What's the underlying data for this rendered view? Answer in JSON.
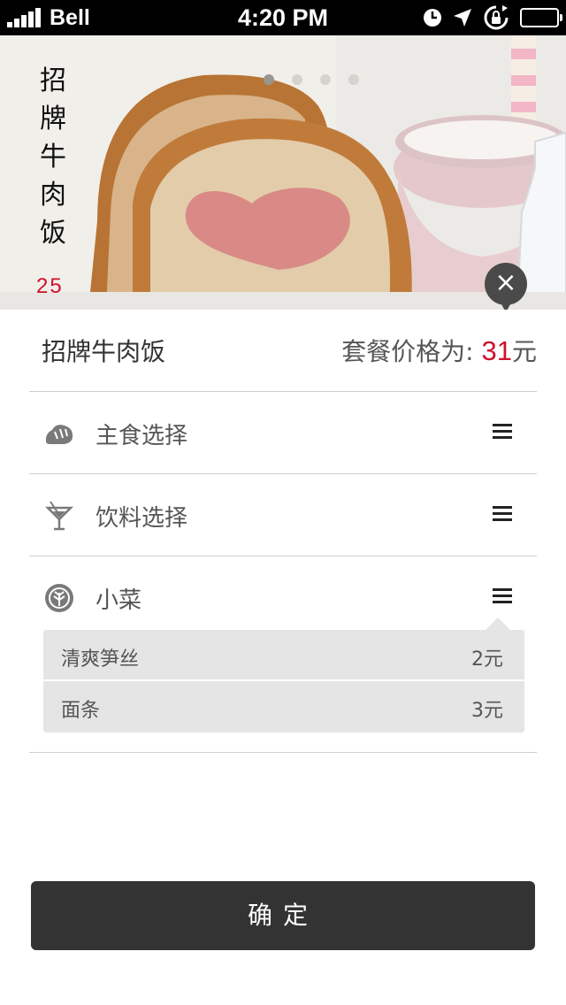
{
  "status_bar": {
    "carrier": "Bell",
    "time": "4:20 PM"
  },
  "hero": {
    "title_chars": [
      "招",
      "牌",
      "牛",
      "肉",
      "饭"
    ],
    "price": "25",
    "carousel": {
      "total": 4,
      "active_index": 0
    }
  },
  "close_label": "×",
  "order": {
    "name": "招牌牛肉饭",
    "price_label": "套餐价格为:",
    "price_value": "31",
    "price_unit": "元"
  },
  "sections": [
    {
      "label": "主食选择",
      "icon": "bread-icon"
    },
    {
      "label": "饮料选择",
      "icon": "cocktail-icon"
    },
    {
      "label": "小菜",
      "icon": "leaf-icon"
    }
  ],
  "side_dishes": [
    {
      "name": "清爽笋丝",
      "price": "2元"
    },
    {
      "name": "面条",
      "price": "3元"
    }
  ],
  "confirm_label": "确定",
  "colors": {
    "accent_red": "#d0112b",
    "button_dark": "#333333"
  }
}
